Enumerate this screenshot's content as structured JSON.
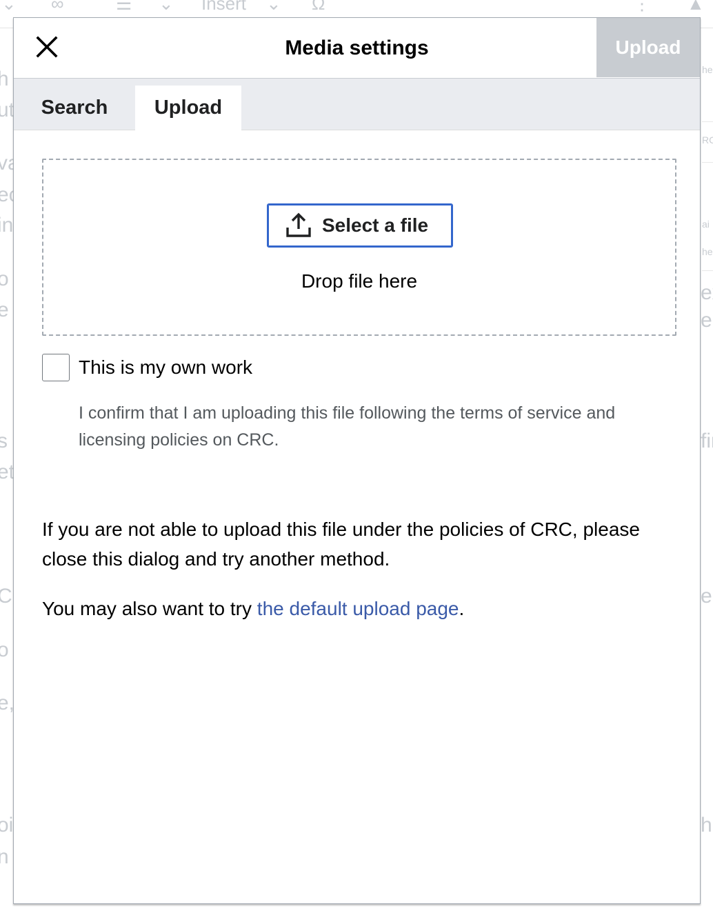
{
  "background": {
    "toolbar_insert_label": "Insert",
    "left_fragments": [
      "h",
      "ut",
      "va",
      "ec",
      "in",
      "o",
      "e",
      "s",
      "eth",
      "C",
      "o e",
      "e,",
      "oi",
      "n"
    ],
    "right_fragments": [
      "he",
      "RC",
      "ai",
      "he",
      "ex",
      "e",
      "fir",
      "e",
      "h"
    ]
  },
  "dialog": {
    "title": "Media settings",
    "primary_action_label": "Upload",
    "close_icon": "close-icon"
  },
  "tabs": [
    {
      "label": "Search",
      "selected": false
    },
    {
      "label": "Upload",
      "selected": true
    }
  ],
  "upload": {
    "select_button_label": "Select a file",
    "select_button_icon": "upload-icon",
    "drop_text": "Drop file here",
    "own_work_label": "This is my own work",
    "own_work_checked": false,
    "help_text": "I confirm that I am uploading this file following the terms of service and licensing policies on CRC.",
    "policy_text": "If you are not able to upload this file under the policies of CRC, please close this dialog and try another method.",
    "alt_prefix": "You may also want to try ",
    "alt_link": "the default upload page",
    "alt_suffix": "."
  },
  "colors": {
    "accent": "#3366cc",
    "link": "#3a5aa8",
    "disabled_button": "#c8ccd1",
    "tabbar": "#eaecf0"
  }
}
